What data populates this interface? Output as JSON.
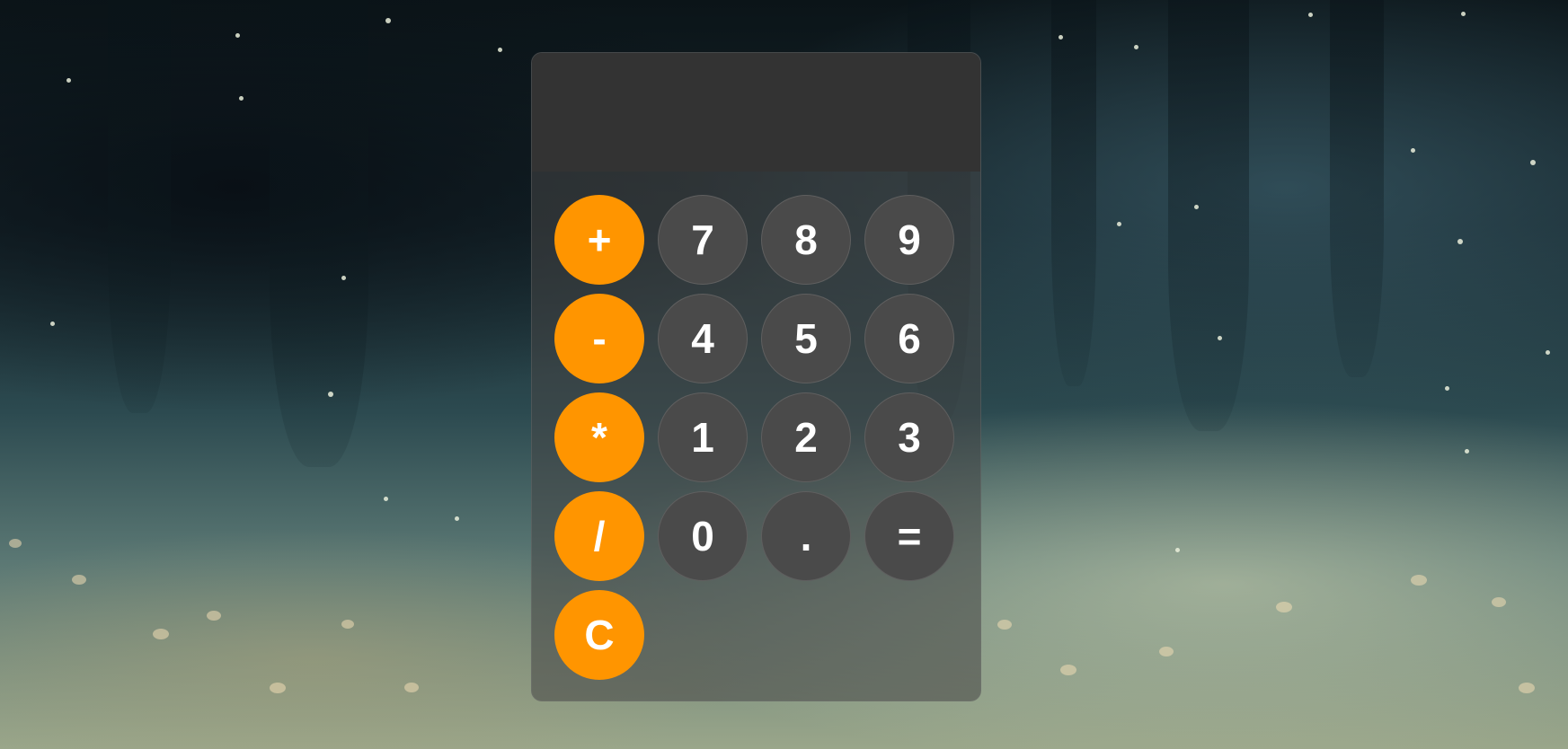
{
  "calculator": {
    "display_value": "",
    "keys": {
      "plus": "+",
      "minus": "-",
      "multiply": "*",
      "divide": "/",
      "clear": "C",
      "seven": "7",
      "eight": "8",
      "nine": "9",
      "four": "4",
      "five": "5",
      "six": "6",
      "one": "1",
      "two": "2",
      "three": "3",
      "zero": "0",
      "decimal": ".",
      "equals": "="
    }
  },
  "colors": {
    "operator": "#ff9500",
    "number": "#4a4a4a",
    "display": "#333333"
  }
}
